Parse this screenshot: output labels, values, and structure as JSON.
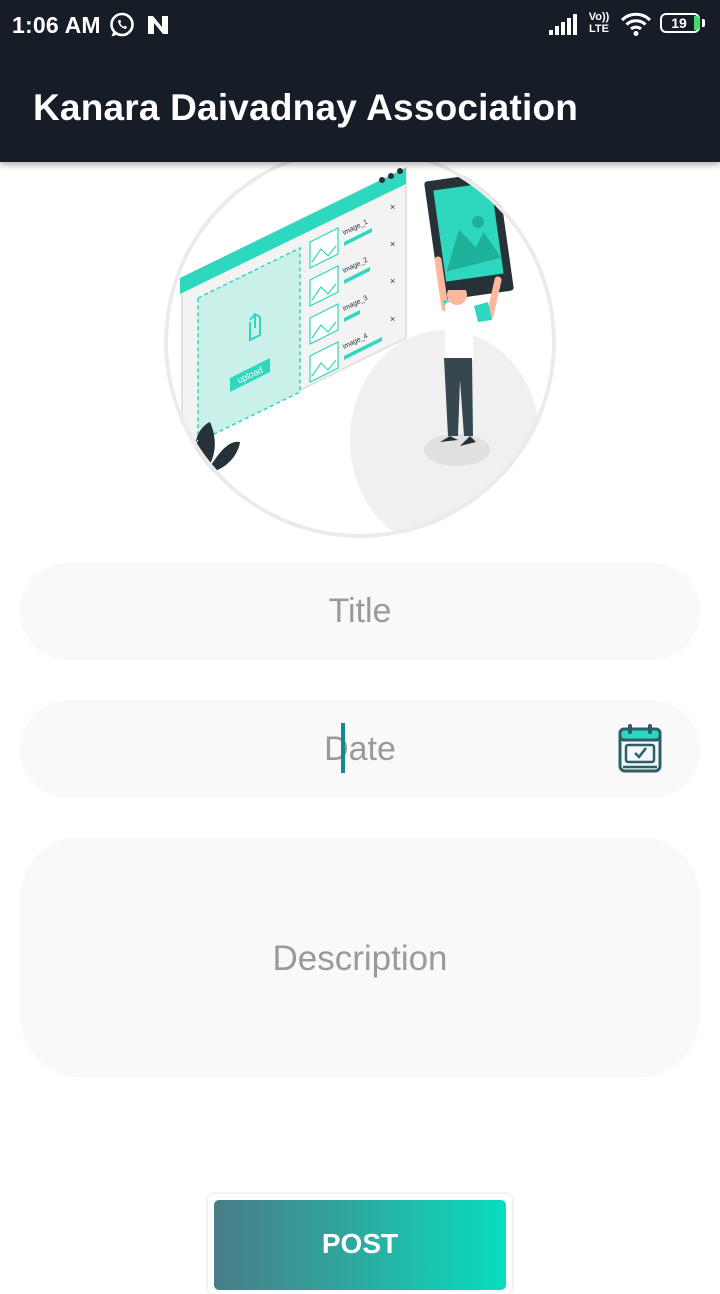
{
  "status_bar": {
    "time": "1:06 AM",
    "volte_top": "Vo))",
    "volte_bottom": "LTE",
    "battery": "19",
    "icons": [
      "whatsapp-icon",
      "n-notification-icon",
      "signal-icon",
      "volte-icon",
      "wifi-icon",
      "battery-icon"
    ]
  },
  "app_bar": {
    "title": "Kanara Daivadnay Association"
  },
  "hero_illustration": {
    "upload_label": "upload",
    "image_items": [
      "image_1",
      "image_2",
      "image_3",
      "image_4"
    ]
  },
  "form": {
    "title_placeholder": "Title",
    "date_placeholder": "Date",
    "description_placeholder": "Description",
    "date_icon": "calendar-check-icon"
  },
  "post_button": {
    "label": "POST"
  },
  "colors": {
    "app_bar": "#171d27",
    "accent": "#07ddc0",
    "gradient_start": "#4a7d88",
    "input_bg": "#f9f9f9",
    "placeholder": "#9a9a9a",
    "caret": "#12898b"
  }
}
